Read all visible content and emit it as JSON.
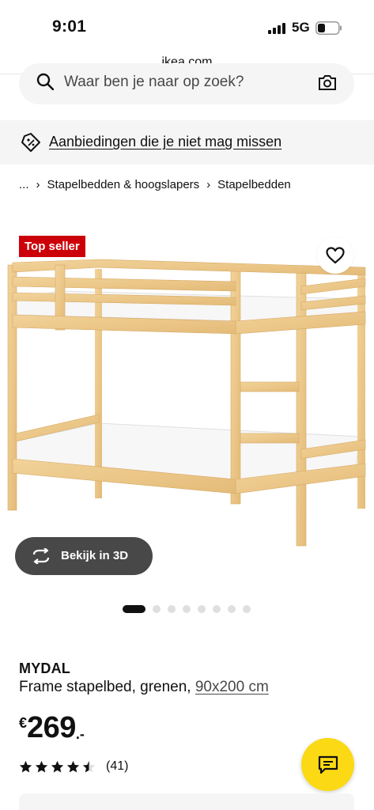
{
  "status_bar": {
    "time": "9:01",
    "network": "5G",
    "icons": [
      "signal-icon",
      "battery-icon"
    ]
  },
  "browser": {
    "url": "ikea.com"
  },
  "search": {
    "placeholder": "Waar ben je naar op zoek?",
    "value": "",
    "icons": [
      "search-icon",
      "camera-icon"
    ]
  },
  "promo": {
    "label": "Aanbiedingen die je niet mag missen",
    "icon": "tag-icon"
  },
  "breadcrumb": {
    "items": [
      "...",
      "Stapelbedden & hoogslapers",
      "Stapelbedden"
    ],
    "separator": "›"
  },
  "product": {
    "badge": "Top seller",
    "badge_color": "#cc0008",
    "view_3d_label": "Bekijk in 3D",
    "image_count": 8,
    "active_image": 1,
    "name": "MYDAL",
    "description": "Frame stapelbed, grenen,",
    "size": "90x200 cm",
    "price": {
      "currency": "€",
      "amount": "269",
      "suffix": ".-"
    },
    "rating": {
      "stars": 4.5,
      "max": 5,
      "count": "(41)"
    }
  },
  "colors": {
    "chat_button": "#fbd914",
    "view_3d_button": "#484848",
    "promo_background": "#f5f5f5"
  }
}
